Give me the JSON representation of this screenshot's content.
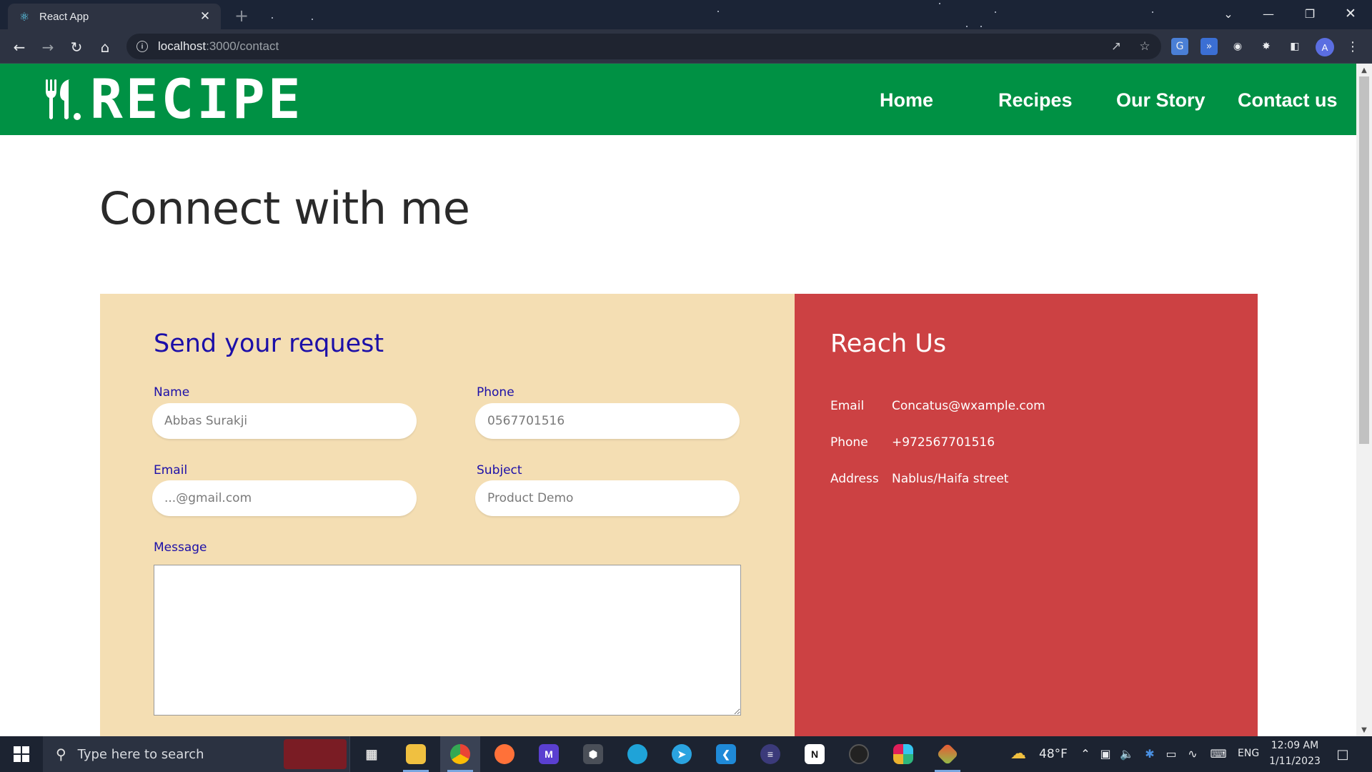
{
  "browser": {
    "tab_title": "React App",
    "url_host": "localhost",
    "url_path": ":3000/contact",
    "profile_initial": "A"
  },
  "site": {
    "logo_text": "RECIPE",
    "nav": [
      "Home",
      "Recipes",
      "Our Story",
      "Contact us"
    ],
    "brand_color": "#009144"
  },
  "page": {
    "title": "Connect with me"
  },
  "form": {
    "heading": "Send your request",
    "name_label": "Name",
    "name_placeholder": "Abbas Surakji",
    "phone_label": "Phone",
    "phone_placeholder": "0567701516",
    "email_label": "Email",
    "email_placeholder": "...@gmail.com",
    "subject_label": "Subject",
    "subject_placeholder": "Product Demo",
    "message_label": "Message",
    "message_value": "",
    "panel_color": "#f4deb3",
    "text_color": "#1c0fa8"
  },
  "reach": {
    "heading": "Reach Us",
    "panel_color": "#cc4143",
    "rows": [
      {
        "label": "Email",
        "value": "Concatus@wxample.com"
      },
      {
        "label": "Phone",
        "value": "+972567701516"
      },
      {
        "label": "Address",
        "value": "Nablus/Haifa street"
      }
    ]
  },
  "taskbar": {
    "search_placeholder": "Type here to search",
    "weather": "48°F",
    "language": "ENG",
    "time": "12:09 AM",
    "date": "1/11/2023",
    "apps": [
      "windows-start-icon",
      "task-view-icon",
      "file-explorer-icon",
      "chrome-icon",
      "firefox-icon",
      "visual-studio-icon",
      "unity-icon",
      "edge-icon",
      "telegram-icon",
      "vscode-icon",
      "eclipse-icon",
      "notion-icon",
      "github-desktop-icon",
      "slack-icon",
      "git-icon"
    ]
  }
}
